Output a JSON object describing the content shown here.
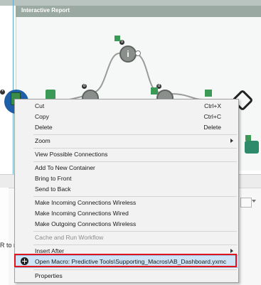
{
  "canvas": {
    "container_title": "Interactive Report"
  },
  "lower_panel": {
    "truncated_text": "R to ru"
  },
  "context_menu": {
    "items": [
      {
        "label": "Cut",
        "shortcut": "Ctrl+X"
      },
      {
        "label": "Copy",
        "shortcut": "Ctrl+C"
      },
      {
        "label": "Delete",
        "shortcut": "Delete"
      },
      {
        "label": "Zoom"
      },
      {
        "label": "View Possible Connections"
      },
      {
        "label": "Add To New Container"
      },
      {
        "label": "Bring to Front"
      },
      {
        "label": "Send to Back"
      },
      {
        "label": "Make Incoming Connections Wireless"
      },
      {
        "label": "Make Incoming Connections Wired"
      },
      {
        "label": "Make Outgoing Connections Wireless"
      },
      {
        "label": "Cache and Run Workflow"
      },
      {
        "label": "Insert After"
      },
      {
        "label": "Open Macro: Predictive Tools\\Supporting_Macros\\AB_Dashboard.yxmc"
      },
      {
        "label": "Properties"
      }
    ]
  },
  "colors": {
    "highlight_box": "#e0141b",
    "selected_tool": "#1f5fa8",
    "menu_background": "#f2f2f2"
  }
}
